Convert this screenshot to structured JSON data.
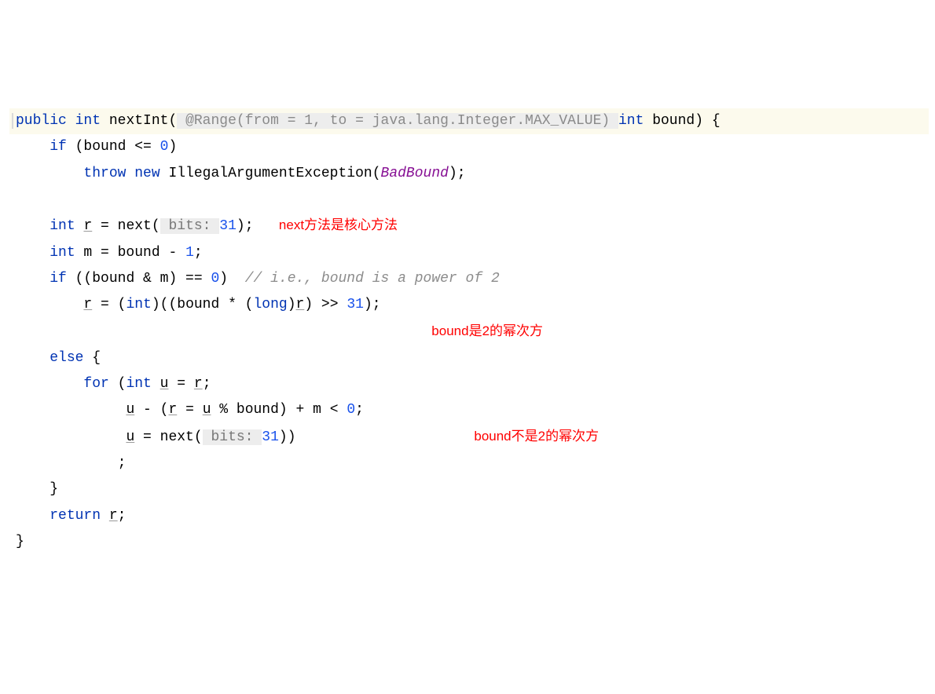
{
  "line1": {
    "public": "public",
    "int": "int",
    "method": "nextInt",
    "lparen": "(",
    "annotation": " @Range(from = 1, to = java.lang.Integer.MAX_VALUE) ",
    "paramType": "int",
    "paramName": " bound",
    "rparen": ")",
    "brace": " {"
  },
  "line2": {
    "kw_if": "if",
    "cond": " (bound <= ",
    "zero": "0",
    "close": ")"
  },
  "line3": {
    "kw_throw": "throw",
    "kw_new": " new ",
    "class": "IllegalArgumentException",
    "lparen": "(",
    "field": "BadBound",
    "rparen": ");"
  },
  "line5": {
    "type": "int",
    "var_r": "r",
    "eq": " = next(",
    "hint": " bits: ",
    "num": "31",
    "close": ");",
    "note": "next方法是核心方法"
  },
  "line6": {
    "type": "int",
    "rest": " m = bound - ",
    "one": "1",
    "semi": ";"
  },
  "line7": {
    "kw_if": "if",
    "cond": " ((bound & m) == ",
    "zero": "0",
    "close": ")  ",
    "comment": "// i.e., bound is a power of 2"
  },
  "line8": {
    "var_r": "r",
    "rest1": " = (",
    "cast_int": "int",
    "rest2": ")((bound * (",
    "cast_long": "long",
    "rest3": ")",
    "var_r2": "r",
    "rest4": ") >> ",
    "num": "31",
    "close": ");"
  },
  "note8": "bound是2的幂次方",
  "line9": {
    "kw_else": "else",
    "brace": " {"
  },
  "line10": {
    "kw_for": "for",
    "lparen": " (",
    "type": "int",
    "sp": " ",
    "var_u": "u",
    "eq": " = ",
    "var_r": "r",
    "semi": ";"
  },
  "line11": {
    "var_u": "u",
    "rest1": " - (",
    "var_r": "r",
    "eq": " = ",
    "var_u2": "u",
    "rest2": " % bound) + m < ",
    "zero": "0",
    "semi": ";"
  },
  "line12": {
    "var_u": "u",
    "eq": " = next(",
    "hint": " bits: ",
    "num": "31",
    "close": "))"
  },
  "note12": "bound不是2的幂次方",
  "line13": ";",
  "line14": "}",
  "line15": {
    "kw_return": "return",
    "sp": " ",
    "var_r": "r",
    "semi": ";"
  },
  "line16": "}"
}
